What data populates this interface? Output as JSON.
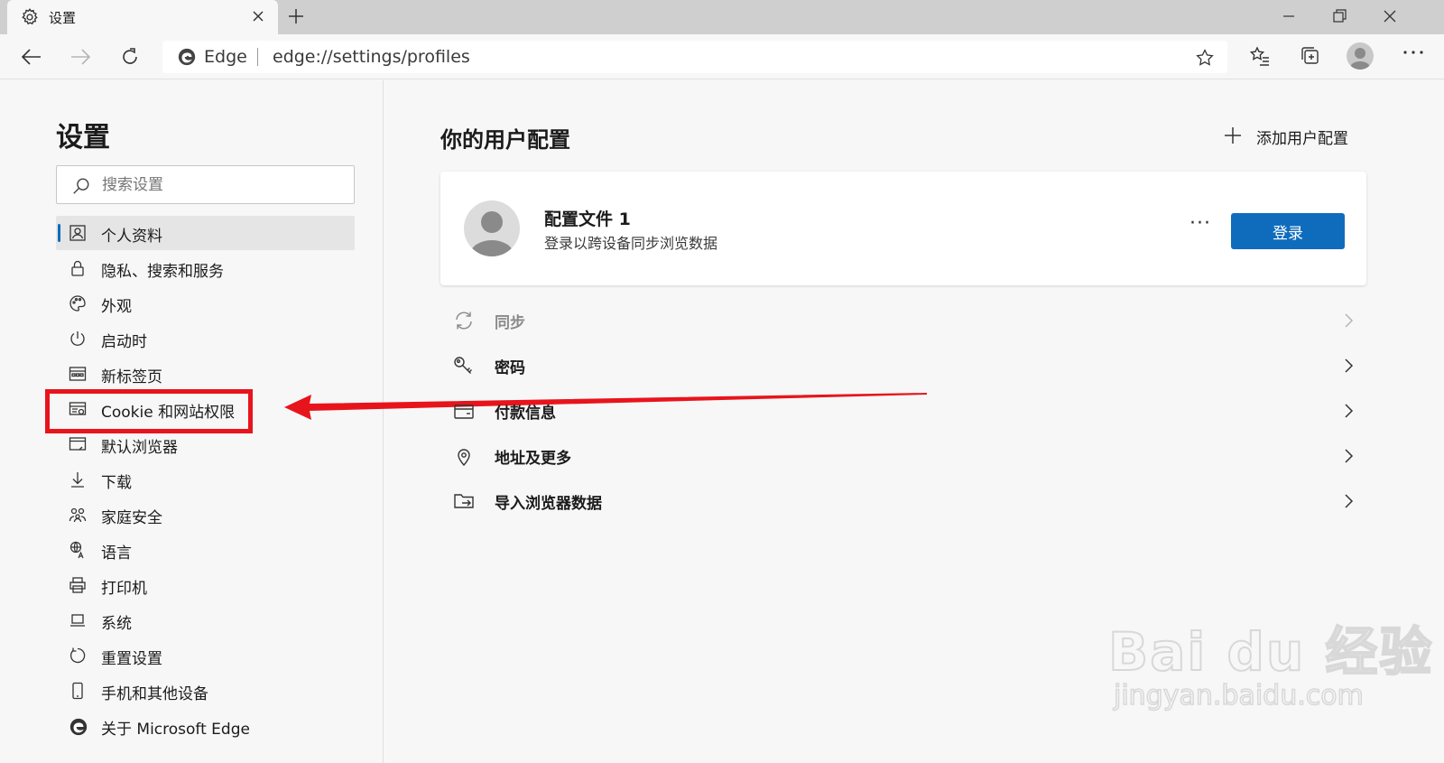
{
  "tab": {
    "title": "设置"
  },
  "address_bar": {
    "brand": "Edge",
    "url": "edge://settings/profiles"
  },
  "sidebar": {
    "heading": "设置",
    "search_placeholder": "搜索设置",
    "items": [
      {
        "label": "个人资料",
        "icon": "profile-icon",
        "active": true
      },
      {
        "label": "隐私、搜索和服务",
        "icon": "lock-icon"
      },
      {
        "label": "外观",
        "icon": "palette-icon"
      },
      {
        "label": "启动时",
        "icon": "power-icon"
      },
      {
        "label": "新标签页",
        "icon": "newtab-page-icon"
      },
      {
        "label": "Cookie 和网站权限",
        "icon": "site-permissions-icon"
      },
      {
        "label": "默认浏览器",
        "icon": "browser-window-icon"
      },
      {
        "label": "下载",
        "icon": "download-icon"
      },
      {
        "label": "家庭安全",
        "icon": "family-icon"
      },
      {
        "label": "语言",
        "icon": "language-icon"
      },
      {
        "label": "打印机",
        "icon": "printer-icon"
      },
      {
        "label": "系统",
        "icon": "laptop-icon"
      },
      {
        "label": "重置设置",
        "icon": "reset-icon"
      },
      {
        "label": "手机和其他设备",
        "icon": "phone-icon"
      },
      {
        "label": "关于 Microsoft Edge",
        "icon": "edge-logo-icon"
      }
    ]
  },
  "main": {
    "title": "你的用户配置",
    "add_profile_label": "添加用户配置",
    "profile": {
      "name": "配置文件 1",
      "description": "登录以跨设备同步浏览数据",
      "more_label": "···",
      "signin_label": "登录"
    },
    "rows": [
      {
        "label": "同步",
        "icon": "sync-icon",
        "disabled": true
      },
      {
        "label": "密码",
        "icon": "key-icon"
      },
      {
        "label": "付款信息",
        "icon": "wallet-icon"
      },
      {
        "label": "地址及更多",
        "icon": "location-pin-icon"
      },
      {
        "label": "导入浏览器数据",
        "icon": "import-folder-icon"
      }
    ]
  },
  "watermark": {
    "logo": "Bai du 经验",
    "url": "jingyan.baidu.com"
  },
  "colors": {
    "accent": "#0f6cbd",
    "highlight": "#e8141c",
    "background": "#f7f7f7"
  }
}
